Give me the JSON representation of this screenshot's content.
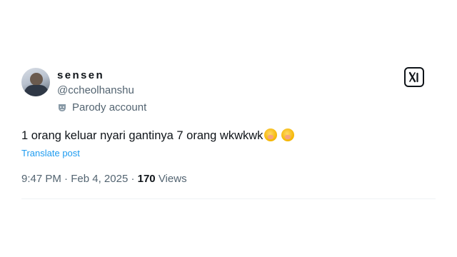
{
  "user": {
    "display_name": "sensen",
    "handle": "@ccheolhanshu",
    "parody_label": "Parody account"
  },
  "tweet": {
    "text": "1 orang keluar nyari gantinya 7 orang wkwkwk",
    "emojis": [
      "face-with-hand-over-mouth",
      "face-with-hand-over-mouth"
    ],
    "translate_label": "Translate post"
  },
  "meta": {
    "time": "9:47 PM",
    "sep1": "·",
    "date": "Feb 4, 2025",
    "sep2": "·",
    "views_count": "170",
    "views_label": "Views"
  },
  "icons": {
    "brand": "x-logo",
    "parody": "theater-mask-icon"
  },
  "colors": {
    "link": "#1d9bf0",
    "secondary": "#536471",
    "primary": "#0f1419"
  }
}
